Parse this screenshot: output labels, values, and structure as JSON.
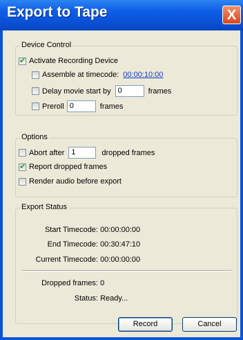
{
  "window": {
    "title": "Export to Tape",
    "close_glyph": "X"
  },
  "device_control": {
    "label": "Device Control",
    "activate": {
      "label": "Activate Recording Device",
      "checked": true
    },
    "assemble": {
      "label": "Assemble at timecode:",
      "checked": false,
      "timecode": "00:00:10:00"
    },
    "delay": {
      "label": "Delay movie start by",
      "checked": false,
      "value": "0",
      "unit": "frames"
    },
    "preroll": {
      "label": "Preroll",
      "checked": false,
      "value": "0",
      "unit": "frames"
    }
  },
  "options": {
    "label": "Options",
    "abort": {
      "label": "Abort after",
      "checked": false,
      "value": "1",
      "unit": "dropped frames"
    },
    "report": {
      "label": "Report dropped frames",
      "checked": true
    },
    "render_audio": {
      "label": "Render audio before export",
      "checked": false
    }
  },
  "export_status": {
    "label": "Export Status",
    "start_label": "Start Timecode:",
    "start_value": "00:00:00:00",
    "end_label": "End Timecode:",
    "end_value": "00:30:47:10",
    "current_label": "Current Timecode:",
    "current_value": "00:00:00:00",
    "dropped_label": "Dropped frames:",
    "dropped_value": "0",
    "status_label": "Status:",
    "status_value": "Ready..."
  },
  "buttons": {
    "record": "Record",
    "cancel": "Cancel"
  },
  "colors": {
    "titlebar": "#0a53d8",
    "dialog_bg": "#ece9d8",
    "link": "#0b3bcf",
    "close": "#d9461d"
  }
}
